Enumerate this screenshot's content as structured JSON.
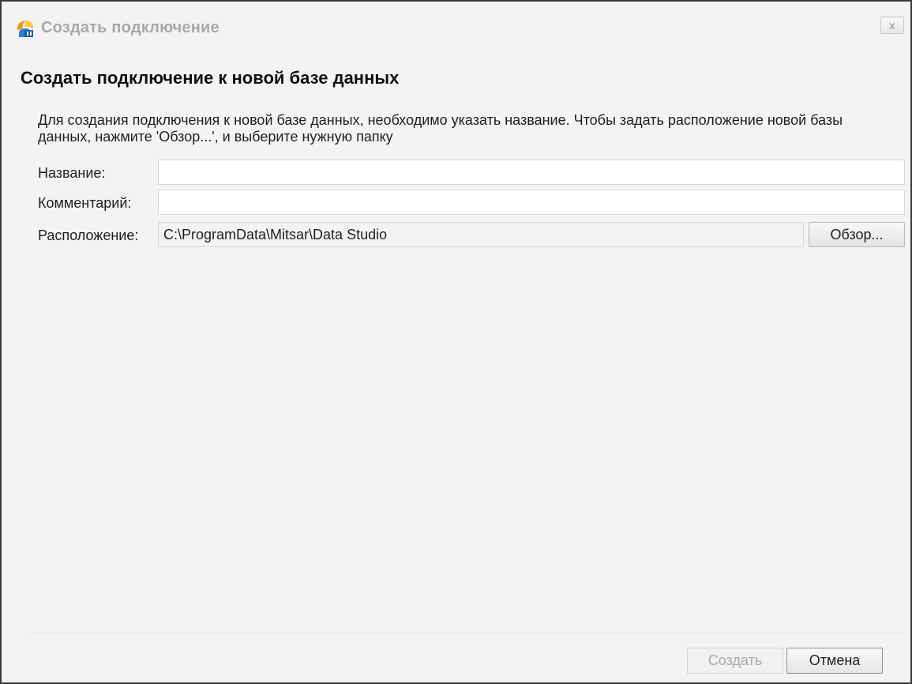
{
  "window": {
    "title": "Создать подключение",
    "close_glyph": "x",
    "icon": "app-logo-icon"
  },
  "page": {
    "title": "Создать подключение к новой базе данных",
    "description": "Для создания подключения к новой базе данных, необходимо указать название. Чтобы задать расположение новой базы данных, нажмите 'Обзор...', и выберите нужную папку"
  },
  "form": {
    "name_label": "Название:",
    "name_value": "",
    "comment_label": "Комментарий:",
    "comment_value": "",
    "location_label": "Расположение:",
    "location_value": "C:\\ProgramData\\Mitsar\\Data Studio",
    "browse_label": "Обзор..."
  },
  "footer": {
    "create_label": "Создать",
    "create_disabled": true,
    "cancel_label": "Отмена"
  },
  "colors": {
    "window_bg": "#f3f3f3",
    "title_text": "#a8a8a8",
    "disabled_text": "#a9a9a9"
  }
}
